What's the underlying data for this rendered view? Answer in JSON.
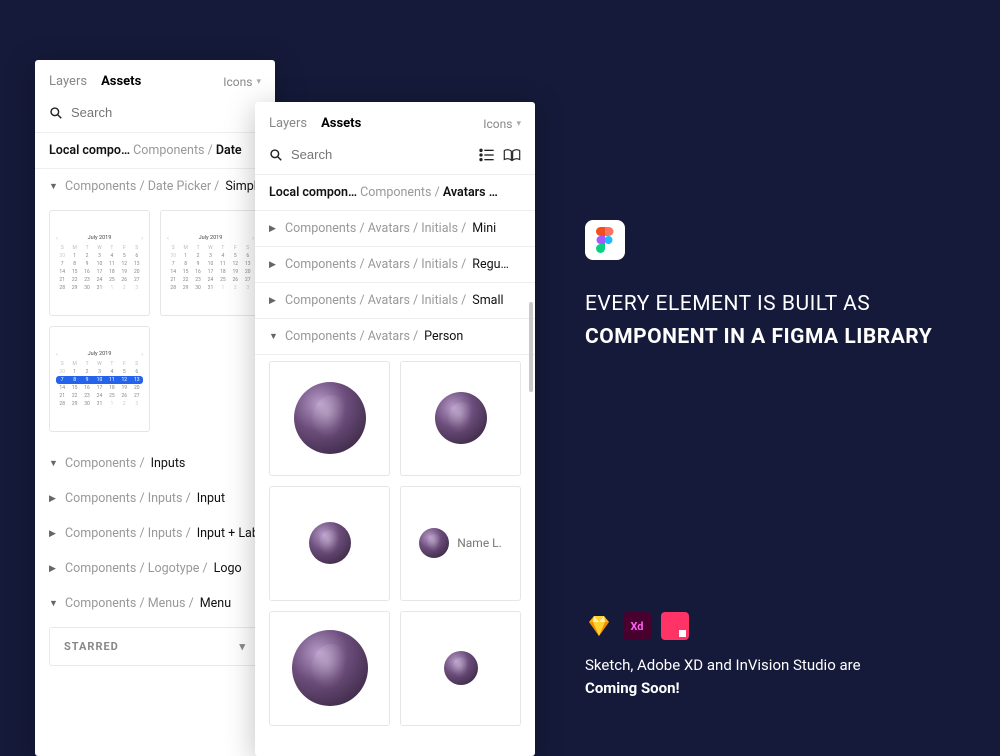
{
  "colors": {
    "bg": "#151a3a",
    "accent": "#2563eb"
  },
  "right": {
    "headline_plain": "Every element is built as",
    "headline_bold": "component in a Figma library"
  },
  "coming": {
    "apps": [
      {
        "name": "Sketch",
        "id": "sketch"
      },
      {
        "name": "Adobe XD",
        "short": "Xd",
        "id": "xd"
      },
      {
        "name": "InVision Studio",
        "id": "invision"
      }
    ],
    "line1": "Sketch, Adobe XD and InVision Studio are",
    "line2_bold": "Coming Soon!"
  },
  "panel_back": {
    "tabs": {
      "layers": "Layers",
      "assets": "Assets",
      "active": "assets"
    },
    "page_selector": "Icons",
    "search_placeholder": "Search",
    "breadcrumb": {
      "label": "Local compo…",
      "path_dim": "Components / ",
      "path_em": "Date"
    },
    "section_open": {
      "path_dim": "Components / Date Picker / ",
      "path_em": "Simpl"
    },
    "calendar": {
      "title": "July 2019",
      "dows": [
        "S",
        "M",
        "T",
        "W",
        "T",
        "F",
        "S"
      ],
      "rows": [
        [
          "30",
          "1",
          "2",
          "3",
          "4",
          "5",
          "6"
        ],
        [
          "7",
          "8",
          "9",
          "10",
          "11",
          "12",
          "13"
        ],
        [
          "14",
          "15",
          "16",
          "17",
          "18",
          "19",
          "20"
        ],
        [
          "21",
          "22",
          "23",
          "24",
          "25",
          "26",
          "27"
        ],
        [
          "28",
          "29",
          "30",
          "31",
          "1",
          "2",
          "3"
        ]
      ],
      "range_row_index": 1,
      "range_start_col": 0,
      "range_end_col": 6
    },
    "sections": [
      {
        "open": true,
        "path_dim": "Components / ",
        "path_em": "Inputs"
      },
      {
        "open": false,
        "path_dim": "Components / Inputs / ",
        "path_em": "Input"
      },
      {
        "open": false,
        "path_dim": "Components / Inputs / ",
        "path_em": "Input + Lab"
      },
      {
        "open": false,
        "path_dim": "Components / Logotype / ",
        "path_em": "Logo"
      },
      {
        "open": true,
        "path_dim": "Components / Menus / ",
        "path_em": "Menu"
      }
    ],
    "starred_label": "STARRED"
  },
  "panel_front": {
    "tabs": {
      "layers": "Layers",
      "assets": "Assets",
      "active": "assets"
    },
    "page_selector": "Icons",
    "search_placeholder": "Search",
    "breadcrumb": {
      "label": "Local compon…",
      "path_dim": "Components / ",
      "path_em": "Avatars …"
    },
    "sections": [
      {
        "open": false,
        "path_dim": "Components / Avatars / Initials / ",
        "path_em": "Mini"
      },
      {
        "open": false,
        "path_dim": "Components / Avatars / Initials / ",
        "path_em": "Regu…"
      },
      {
        "open": false,
        "path_dim": "Components / Avatars / Initials / ",
        "path_em": "Small"
      },
      {
        "open": true,
        "path_dim": "Components / Avatars / ",
        "path_em": "Person"
      }
    ],
    "avatar_items": [
      {
        "size": 72,
        "label": null
      },
      {
        "size": 52,
        "label": null
      },
      {
        "size": 42,
        "label": null
      },
      {
        "size": 30,
        "label": "Name L."
      },
      {
        "size": 76,
        "label": null
      },
      {
        "size": 34,
        "label": null
      }
    ]
  }
}
